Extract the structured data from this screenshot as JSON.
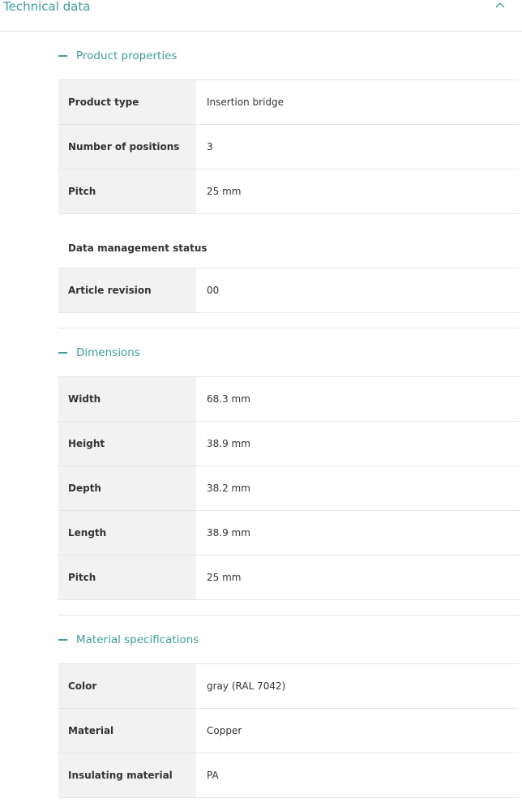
{
  "header": {
    "title": "Technical data"
  },
  "sections": {
    "product_properties": {
      "title": "Product properties",
      "rows": [
        {
          "label": "Product type",
          "value": "Insertion bridge"
        },
        {
          "label": "Number of positions",
          "value": "3"
        },
        {
          "label": "Pitch",
          "value": "25 mm"
        }
      ],
      "subheading": "Data management status",
      "sub_rows": [
        {
          "label": "Article revision",
          "value": "00"
        }
      ]
    },
    "dimensions": {
      "title": "Dimensions",
      "rows": [
        {
          "label": "Width",
          "value": "68.3 mm"
        },
        {
          "label": "Height",
          "value": "38.9 mm"
        },
        {
          "label": "Depth",
          "value": "38.2 mm"
        },
        {
          "label": "Length",
          "value": "38.9 mm"
        },
        {
          "label": "Pitch",
          "value": "25 mm"
        }
      ]
    },
    "material": {
      "title": "Material specifications",
      "rows": [
        {
          "label": "Color",
          "value": "gray (RAL 7042)"
        },
        {
          "label": "Material",
          "value": "Copper"
        },
        {
          "label": "Insulating material",
          "value": "PA"
        }
      ]
    }
  },
  "colors": {
    "accent": "#3e9c9a",
    "label_bg": "#f2f2f2",
    "divider": "#e5e5e5"
  },
  "icons": {
    "collapse": "chevron-up-icon",
    "section_toggle": "minus-icon"
  }
}
